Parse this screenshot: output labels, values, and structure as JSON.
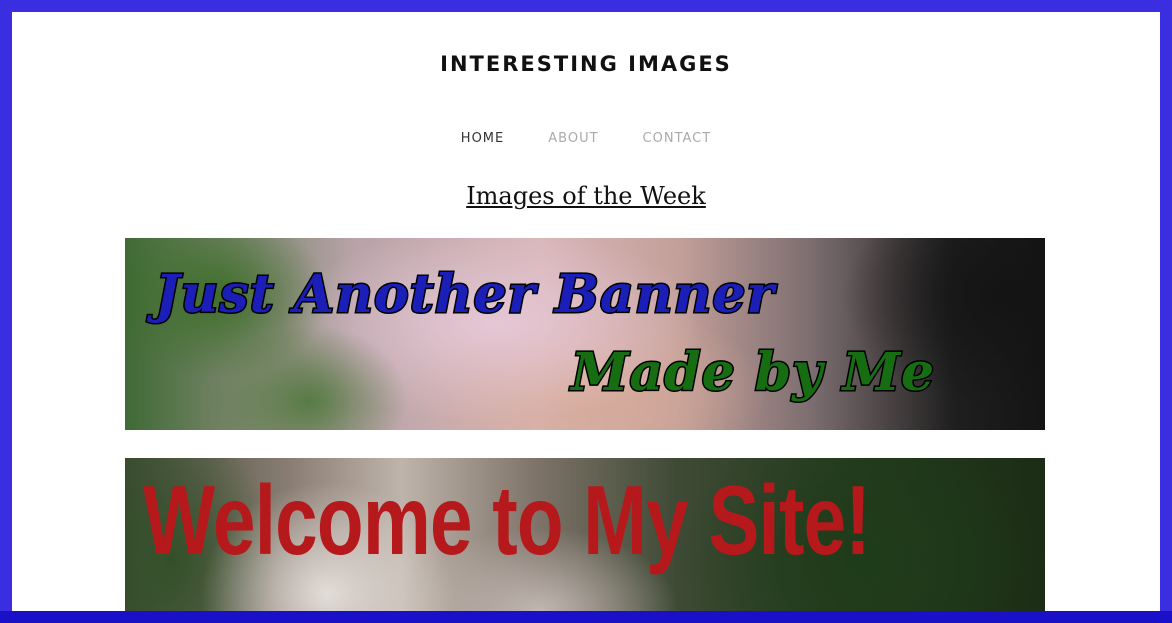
{
  "site": {
    "title": "INTERESTING IMAGES"
  },
  "nav": {
    "items": [
      {
        "label": "HOME"
      },
      {
        "label": "ABOUT"
      },
      {
        "label": "CONTACT"
      }
    ]
  },
  "main": {
    "heading": "Images of the Week",
    "banners": [
      {
        "line1": "Just Another Banner",
        "line2": "Made by Me"
      },
      {
        "text": "Welcome to My Site!"
      }
    ]
  },
  "colors": {
    "frame": "#3a2ee0",
    "banner1_line1": "#1b1fb8",
    "banner1_line2": "#176e12",
    "banner2_text": "#b5191c"
  }
}
